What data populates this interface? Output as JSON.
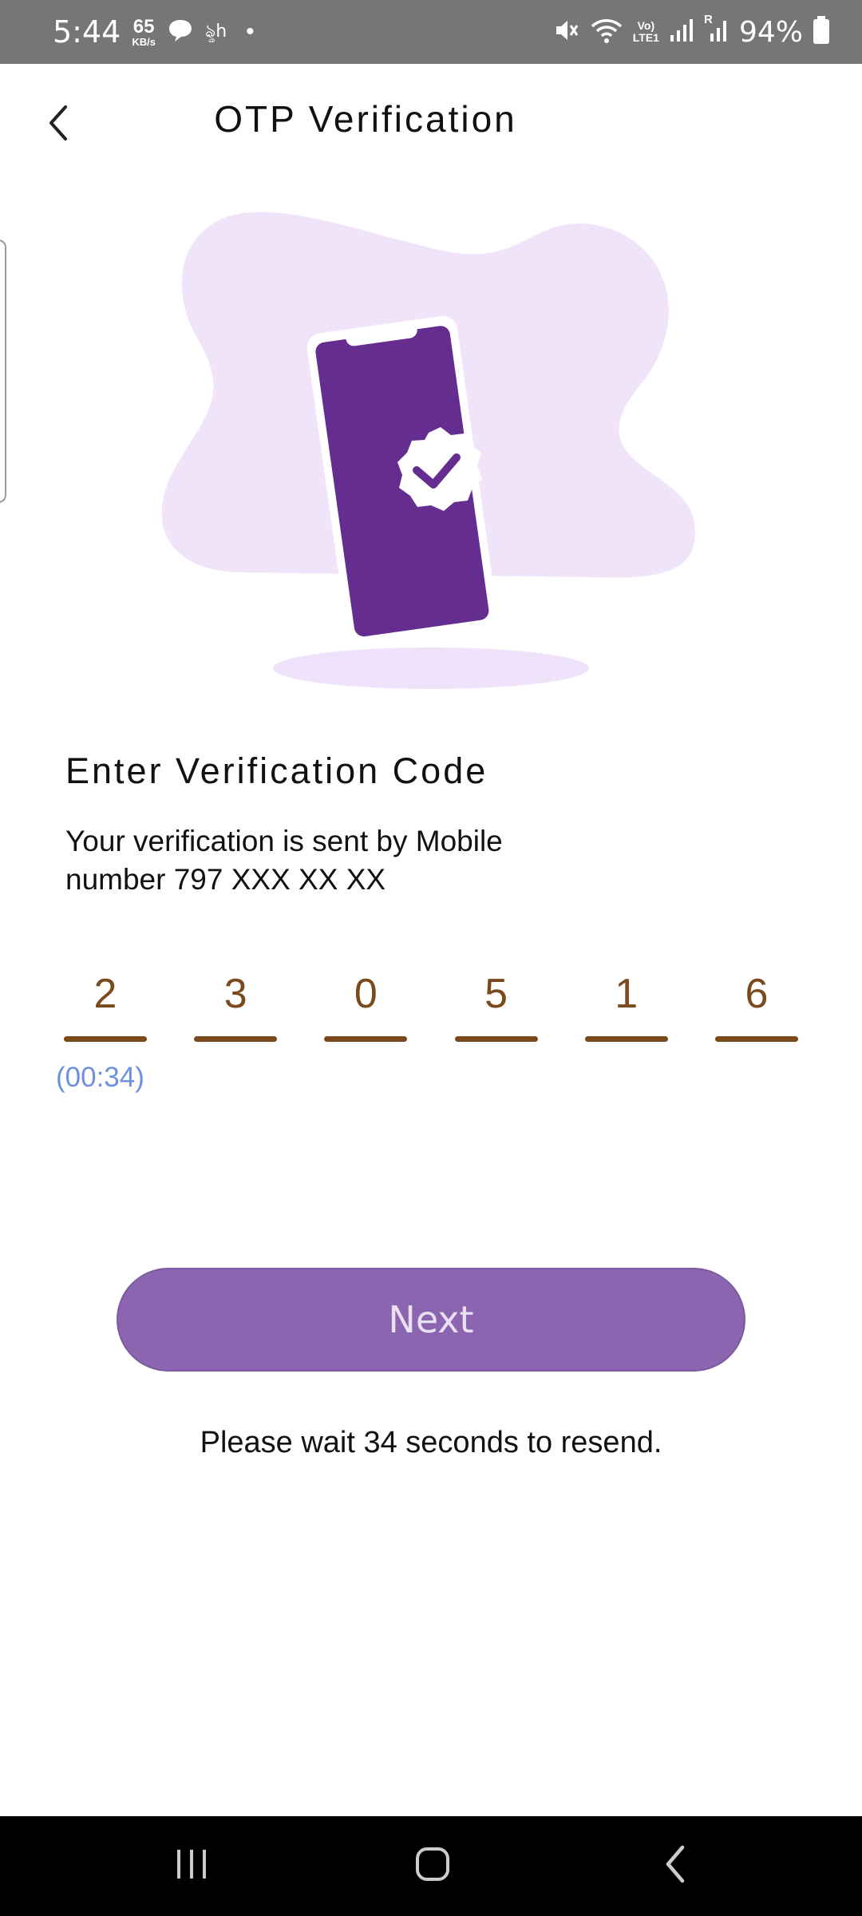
{
  "status_bar": {
    "time": "5:44",
    "speed_value": "65",
    "speed_unit": "KB/s",
    "chat_glyph": "ৡh",
    "dot": "•",
    "network_top": "Vo)",
    "network_bottom": "LTE1",
    "sim_label": "R",
    "battery_percent": "94%"
  },
  "header": {
    "title": "OTP Verification",
    "icons": {
      "back": "chevron-left-icon"
    }
  },
  "illustration": {
    "icons": {
      "main": "phone-verified-icon"
    },
    "colors": {
      "blob": "#f0e4fb",
      "phone": "#652d90",
      "shadow": "#efe3fb"
    }
  },
  "content": {
    "title": "Enter Verification Code",
    "description_line1": "Your verification is sent by Mobile",
    "description_line2": "number 797 XXX XX XX"
  },
  "otp": {
    "digits": [
      "2",
      "3",
      "0",
      "5",
      "1",
      "6"
    ],
    "timer": "(00:34)",
    "colors": {
      "digit": "#7b4a1c",
      "timer": "#6f8fe0"
    }
  },
  "actions": {
    "next_label": "Next",
    "resend_note": "Please wait 34 seconds to resend.",
    "colors": {
      "button": "#8c65b0"
    }
  },
  "nav_bar": {
    "icons": {
      "recents": "recents-icon",
      "home": "home-icon",
      "back": "nav-back-icon"
    }
  }
}
